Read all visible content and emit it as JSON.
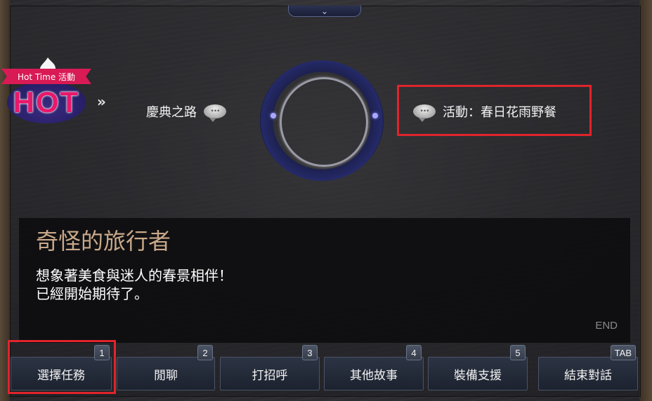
{
  "top_tab": {
    "icon": "chevron-down-icon",
    "glyph": "⌄"
  },
  "hot_logo": {
    "ribbon_text": "Hot Time 活動",
    "text": "HOT"
  },
  "nav_arrows": "»",
  "options": [
    {
      "label": "慶典之路",
      "icon": "speech-bubble-icon",
      "bubble_text": "•••"
    },
    {
      "label": "活動：春日花雨野餐",
      "icon": "speech-bubble-icon",
      "bubble_text": "•••",
      "highlighted": true
    }
  ],
  "dialog": {
    "npc_name": "奇怪的旅行者",
    "line1": "想象著美食與迷人的春景相伴！",
    "line2": "已經開始期待了。",
    "end_label": "END"
  },
  "buttons": [
    {
      "label": "選擇任務",
      "key": "1",
      "highlighted": true
    },
    {
      "label": "閒聊",
      "key": "2"
    },
    {
      "label": "打招呼",
      "key": "3"
    },
    {
      "label": "其他故事",
      "key": "4"
    },
    {
      "label": "裝備支援",
      "key": "5"
    },
    {
      "label": "結束對話",
      "key": "TAB"
    }
  ],
  "colors": {
    "highlight": "#e0242c",
    "npc_name": "#c9a98a",
    "hot_pink": "#d81a55"
  }
}
